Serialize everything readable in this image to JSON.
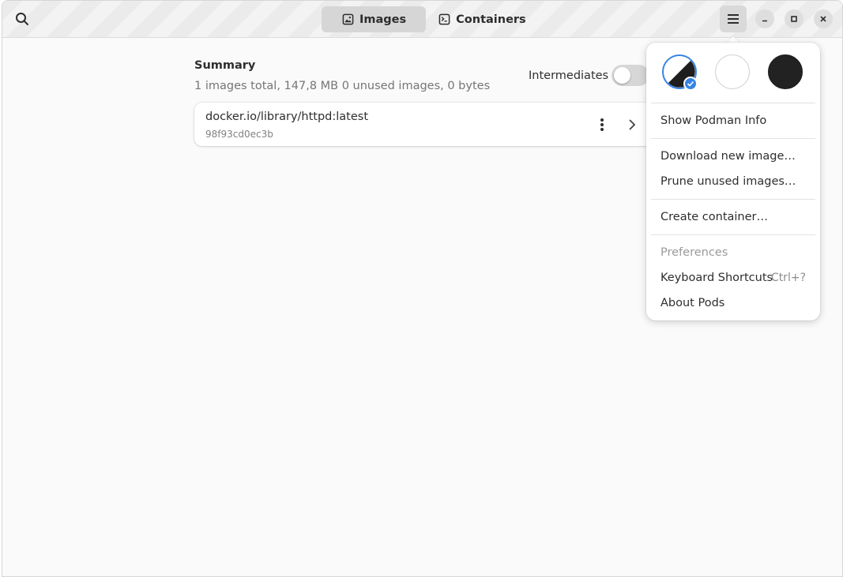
{
  "header": {
    "tabs": [
      {
        "label": "Images",
        "icon": "image-icon",
        "active": true
      },
      {
        "label": "Containers",
        "icon": "terminal-icon",
        "active": false
      }
    ]
  },
  "summary": {
    "title": "Summary",
    "subtitle": "1 images total, 147,8 MB  0 unused images, 0 bytes",
    "intermediates_label": "Intermediates",
    "intermediates_on": false
  },
  "images": [
    {
      "name": "docker.io/library/httpd:latest",
      "id": "98f93cd0ec3b"
    }
  ],
  "menu": {
    "themes": [
      "system",
      "light",
      "dark"
    ],
    "selected_theme": "system",
    "accent": "#3584e4",
    "items": {
      "show_info": "Show Podman Info",
      "download": "Download new image…",
      "prune": "Prune unused images…",
      "create": "Create container…",
      "preferences": "Preferences",
      "shortcuts": "Keyboard Shortcuts",
      "shortcuts_accel": "Ctrl+?",
      "about": "About Pods"
    }
  }
}
